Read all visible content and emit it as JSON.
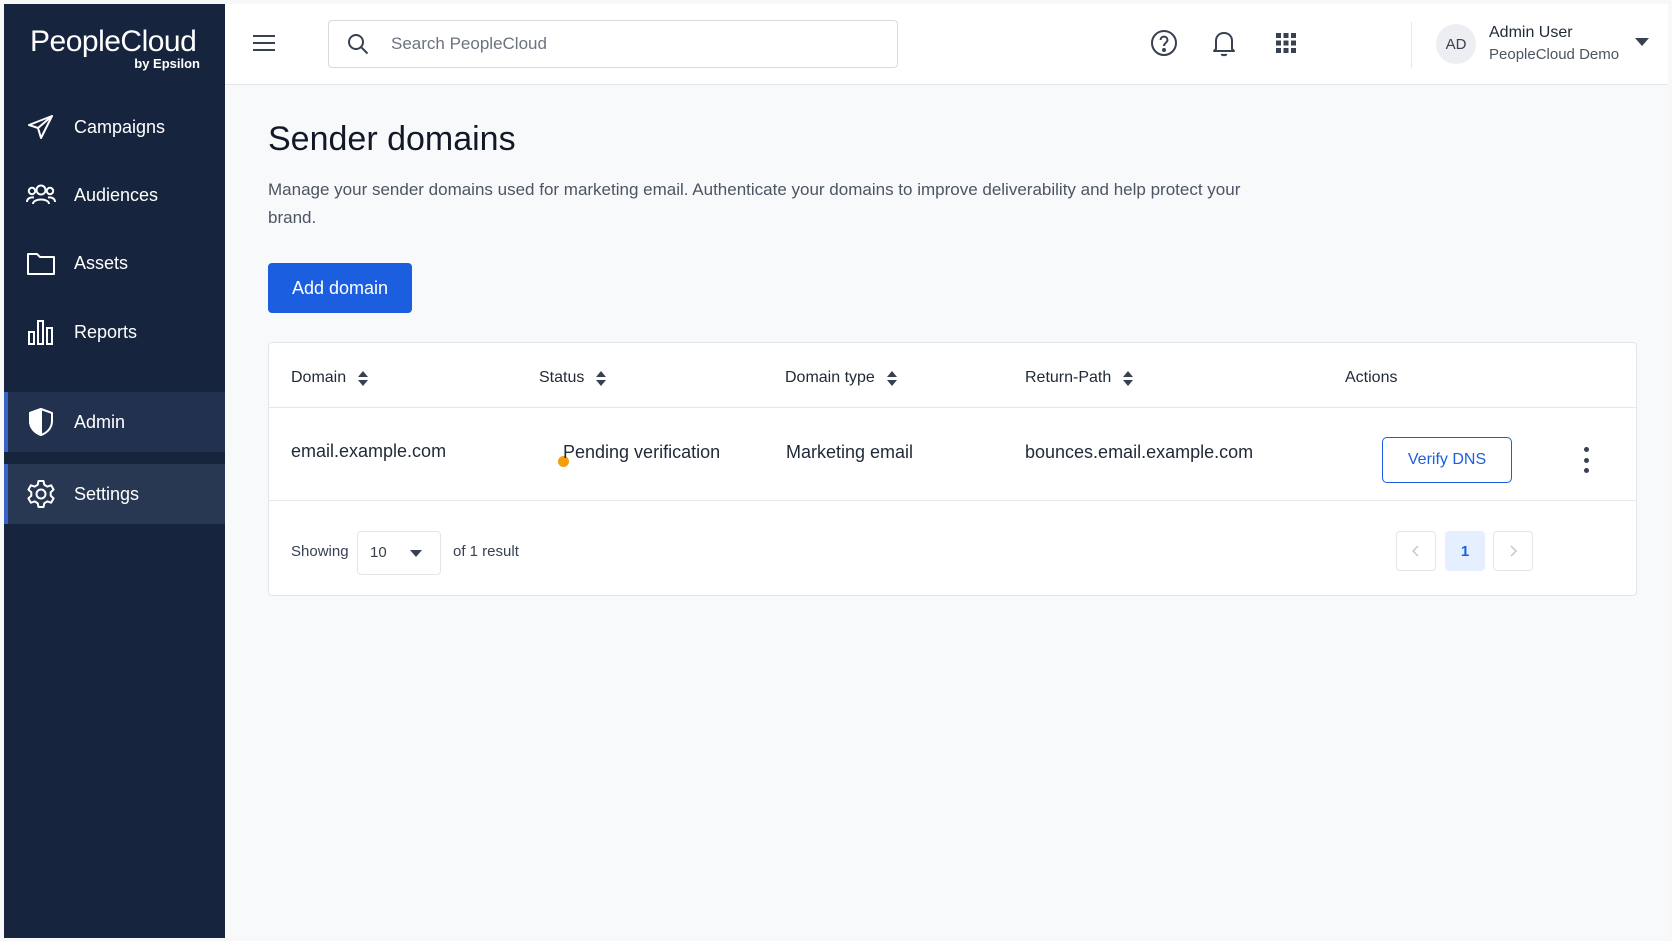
{
  "brand": {
    "name": "PeopleCloud",
    "byline": "by Epsilon"
  },
  "sidebar": {
    "items": [
      {
        "label": "Campaigns",
        "icon": "paper-plane-icon"
      },
      {
        "label": "Audiences",
        "icon": "users-icon"
      },
      {
        "label": "Assets",
        "icon": "folder-icon"
      },
      {
        "label": "Reports",
        "icon": "bar-chart-icon"
      },
      {
        "label": "Admin",
        "icon": "shield-icon"
      },
      {
        "label": "Settings",
        "icon": "gear-icon"
      }
    ],
    "active": "Settings"
  },
  "header": {
    "search_placeholder": "Search PeopleCloud",
    "icons": [
      "help-icon",
      "bell-icon",
      "apps-grid-icon"
    ],
    "user": {
      "initials": "AD",
      "name": "Admin User",
      "org": "PeopleCloud Demo"
    }
  },
  "page": {
    "title": "Sender domains",
    "description": "Manage your sender domains used for marketing email. Authenticate your domains to improve deliverability and help protect your brand.",
    "add_button": "Add domain"
  },
  "table": {
    "columns": [
      "Domain",
      "Status",
      "Domain type",
      "Return-Path",
      "Actions"
    ],
    "rows": [
      {
        "domain": "email.example.com",
        "status": "Pending verification",
        "status_color": "#f59e0b",
        "domain_type": "Marketing email",
        "return_path": "bounces.email.example.com",
        "action_label": "Verify DNS"
      }
    ]
  },
  "pagination": {
    "showing_label": "Showing",
    "page_size": "10",
    "result_text": "of 1 result",
    "current_page": "1"
  },
  "colors": {
    "sidebar_bg": "#16243e",
    "primary": "#1b5fe0",
    "pending": "#f59e0b"
  }
}
